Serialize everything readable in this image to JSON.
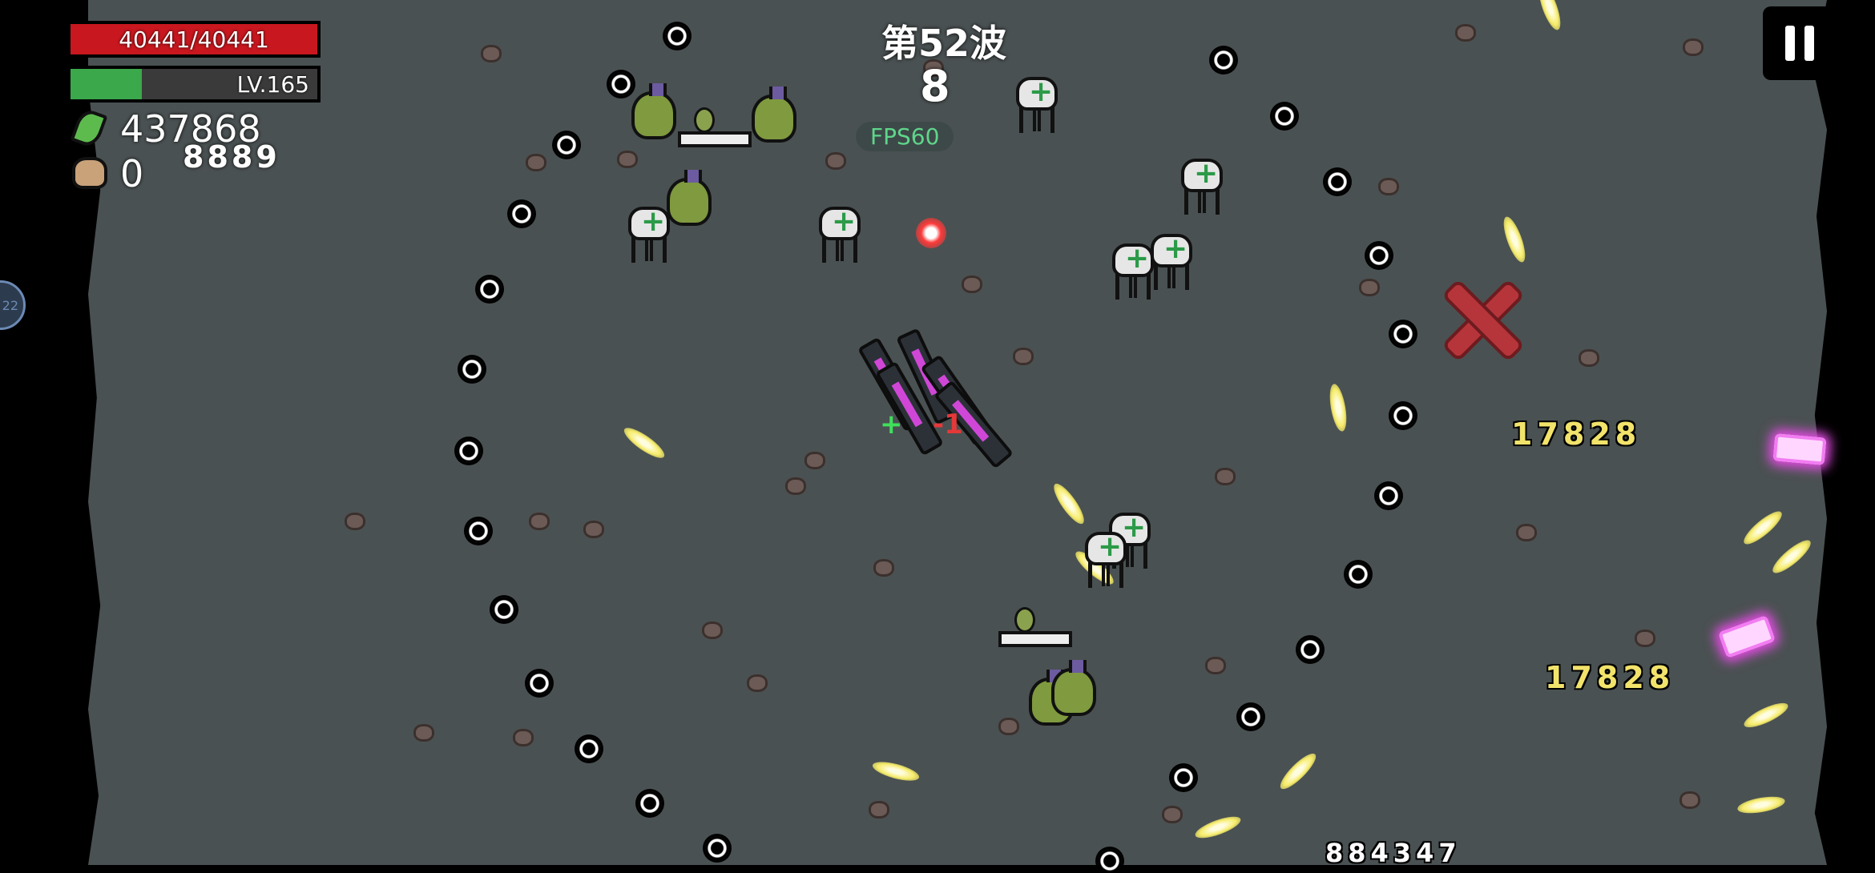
{
  "hud": {
    "hp_text": "40441/40441",
    "hp_fraction": 1.0,
    "hp_color": "#c8171e",
    "level_text": "LV.165",
    "xp_fraction": 0.29,
    "xp_color": "#3aa84b",
    "materials_count": "437868",
    "bag_count": "0",
    "bag_extra": "8889"
  },
  "wave": {
    "title": "第52波",
    "timer": "8",
    "fps": "FPS60"
  },
  "damage_numbers": [
    "17828",
    "17828",
    "884347"
  ],
  "player_floaters": {
    "heal": "+",
    "minus": "-1"
  },
  "icons": {
    "materials": "green-leaf-icon",
    "bag": "loot-bag-icon",
    "pause": "pause-icon",
    "side": "ability-circle-icon"
  },
  "side_button_text": "22"
}
